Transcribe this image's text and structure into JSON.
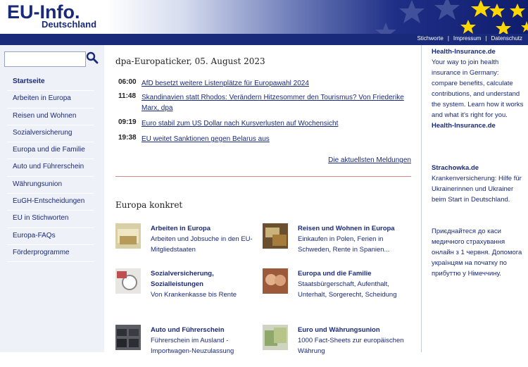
{
  "header": {
    "logo_main": "EU-Info.",
    "logo_sub": "Deutschland",
    "nav_links": [
      "Stichworte",
      "Impressum",
      "Datenschutz"
    ],
    "nav_sep": "|"
  },
  "search": {
    "placeholder": "",
    "icon": "search-icon"
  },
  "sidebar": {
    "items": [
      {
        "label": "Startseite"
      },
      {
        "label": "Arbeiten in Europa"
      },
      {
        "label": "Reisen und Wohnen"
      },
      {
        "label": "Sozialversicherung"
      },
      {
        "label": "Europa und die Familie"
      },
      {
        "label": "Auto und Führerschein"
      },
      {
        "label": "Währungsunion"
      },
      {
        "label": "EuGH-Entscheidungen"
      },
      {
        "label": "EU in Stichworten"
      },
      {
        "label": "Europa-FAQs"
      },
      {
        "label": "Förderprogramme"
      }
    ]
  },
  "ticker": {
    "title": "dpa-Europaticker, 05. August 2023",
    "items": [
      {
        "time": "06:00",
        "text": "AfD besetzt weitere Listenplätze für Europawahl 2024"
      },
      {
        "time": "11:48",
        "text": "Skandinavien statt Rhodos: Verändern Hitzesommer den Tourismus? Von Friederike Marx, dpa"
      },
      {
        "time": "09:19",
        "text": "Euro stabil zum US Dollar nach Kursverlusten auf Wochensicht"
      },
      {
        "time": "19:38",
        "text": "EU weitet Sanktionen gegen Belarus aus"
      }
    ],
    "more": "Die aktuellsten Meldungen"
  },
  "konkret": {
    "title": "Europa konkret",
    "cards": [
      {
        "title": "Arbeiten in Europa",
        "desc": "Arbeiten und Jobsuche in den EU-Mitgliedstaaten"
      },
      {
        "title": "Reisen und Wohnen in Europa",
        "desc": "Einkaufen in Polen, Ferien in Schweden, Rente in Spanien..."
      },
      {
        "title": "Sozialversicherung, Sozialleistungen",
        "desc": "Von Krankenkasse bis Rente"
      },
      {
        "title": "Europa und die Familie",
        "desc": "Staatsbürgerschaft, Aufenthalt, Unterhalt, Sorgerecht, Scheidung"
      },
      {
        "title": "Auto und Führerschein",
        "desc": "Führerschein im Ausland - Importwagen-Neuzulassung"
      },
      {
        "title": "Euro und Währungsunion",
        "desc": "1000 Fact-Sheets zur europäischen Währung"
      }
    ]
  },
  "right": {
    "promo1_title": "Health-Insurance.de",
    "promo1_body": "Your way to join health insurance in Germany: compare benefits, calculate contributions, and understand the system. Learn how it works and what it's right for you.",
    "promo1_link": "Health-Insurance.de",
    "promo2_title": "Strachowka.de",
    "promo2_body": "Krankenversicherung: Hilfe für Ukrainerinnen und Ukrainer beim Start in Deutschland.",
    "promo3_body": "Приєднайтеся до каси медичного страхування онлайн з 1 червня. Допомога українцям на початку по прибуттю у Німеччину."
  },
  "colors": {
    "navy": "#1a2a7a",
    "sidebar_bg": "#eef1f8",
    "star_yellow": "#ffd700",
    "divider": "#d88888"
  }
}
